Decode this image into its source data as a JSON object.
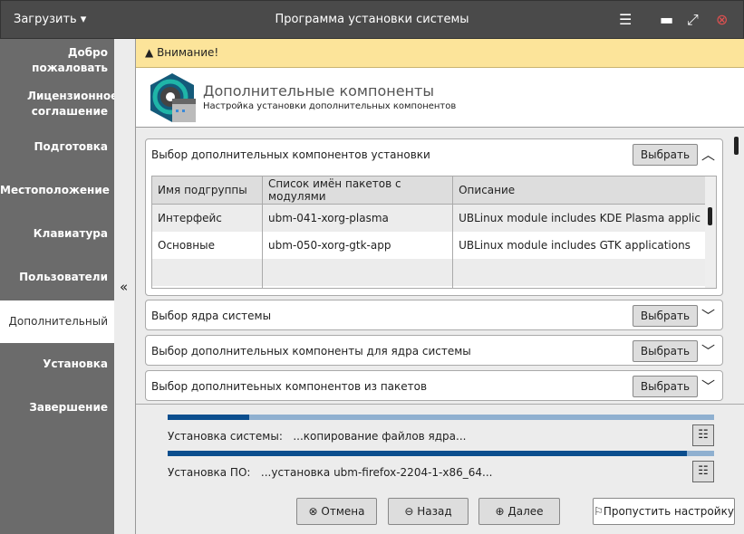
{
  "titlebar": {
    "menu": "Загрузить",
    "title": "Программа установки системы"
  },
  "sidebar": {
    "items": [
      "Добро пожаловать",
      "Лицензионное соглашение",
      "Подготовка",
      "Местоположение",
      "Клавиатура",
      "Пользователи",
      "Дополнительный",
      "Установка",
      "Завершение"
    ],
    "active": 6
  },
  "warning": "Внимание!",
  "header": {
    "title": "Дополнительные компоненты",
    "subtitle": "Настройка установки дополнительных компонентов"
  },
  "sections": [
    {
      "title": "Выбор дополнительных компонентов установки",
      "button": "Выбрать"
    },
    {
      "title": "Выбор ядра системы",
      "button": "Выбрать"
    },
    {
      "title": "Выбор дополнительных компоненты для ядра системы",
      "button": "Выбрать"
    },
    {
      "title": "Выбор дополнитеьных компонентов из пакетов",
      "button": "Выбрать"
    }
  ],
  "table": {
    "headers": [
      "Имя подгруппы",
      "Список имён пакетов с модулями",
      "Описание"
    ],
    "rows": [
      [
        "Интерфейс",
        "ubm-041-xorg-plasma",
        "UBLinux module includes KDE Plasma applic"
      ],
      [
        "Основные",
        "ubm-050-xorg-gtk-app",
        "UBLinux module includes GTK applications"
      ]
    ]
  },
  "progress": [
    {
      "label": "Установка системы:",
      "status": "...копирование файлов ядра...",
      "percent": 15
    },
    {
      "label": "Установка ПО:",
      "status": "...установка ubm-firefox-2204-1-x86_64...",
      "percent": 95
    }
  ],
  "footer": {
    "cancel": "Отмена",
    "back": "Назад",
    "next": "Далее",
    "skip": "Пропустить настройку"
  },
  "colors": {
    "accent": "#0b4e8e",
    "warning_bg": "#fce49a",
    "sidebar": "#6b6b6b"
  }
}
